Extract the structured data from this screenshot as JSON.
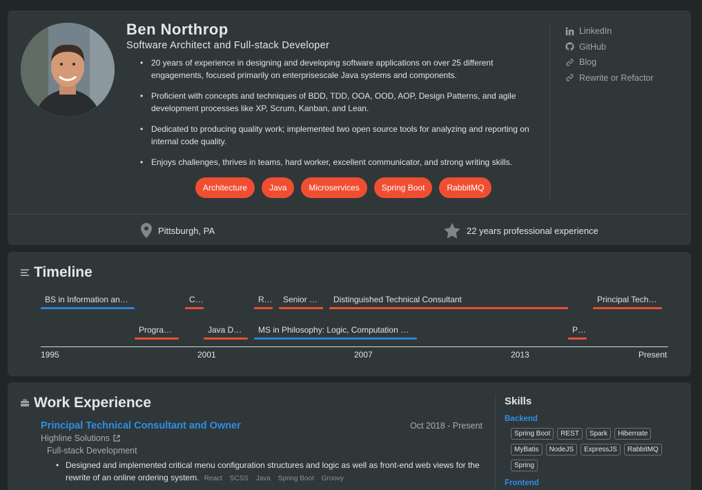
{
  "profile": {
    "name": "Ben Northrop",
    "role": "Software Architect and Full-stack Developer",
    "bullets": [
      "20 years of experience in designing and developing software applications on over 25 different engagements, focused primarily on enterprisescale Java systems and components.",
      "Proficient with concepts and techniques of BDD, TDD, OOA, OOD, AOP, Design Patterns, and agile development processes like XP, Scrum, Kanban, and Lean.",
      "Dedicated to producing quality work; implemented two open source tools for analyzing and reporting on internal code quality.",
      "Enjoys challenges, thrives in teams, hard worker, excellent communicator, and strong writing skills."
    ],
    "tags": [
      "Architecture",
      "Java",
      "Microservices",
      "Spring Boot",
      "RabbitMQ"
    ],
    "links": [
      {
        "label": "LinkedIn",
        "icon": "linkedin-icon"
      },
      {
        "label": "GitHub",
        "icon": "github-icon"
      },
      {
        "label": "Blog",
        "icon": "link-icon"
      },
      {
        "label": "Rewrite or Refactor",
        "icon": "link-icon"
      }
    ],
    "location": "Pittsburgh, PA",
    "experience": "22 years professional experience"
  },
  "timeline": {
    "title": "Timeline",
    "items": [
      {
        "label": "BS in Information and ...",
        "type": "education"
      },
      {
        "label": "Co...",
        "type": "work"
      },
      {
        "label": "Re...",
        "type": "work"
      },
      {
        "label": "Senior C...",
        "type": "work"
      },
      {
        "label": "Distinguished Technical Consultant",
        "type": "work"
      },
      {
        "label": "Principal Techni...",
        "type": "work"
      },
      {
        "label": "Program...",
        "type": "work"
      },
      {
        "label": "Java Dev...",
        "type": "work"
      },
      {
        "label": "MS in Philosophy: Logic, Computation and...",
        "type": "education"
      },
      {
        "label": "Pri...",
        "type": "work"
      }
    ],
    "ticks": [
      "1995",
      "2001",
      "2007",
      "2013",
      "Present"
    ]
  },
  "work": {
    "title": "Work Experience",
    "jobs": [
      {
        "title": "Principal Technical Consultant and Owner",
        "dates": "Oct 2018 - Present",
        "company": "Highline Solutions",
        "role": "Full-stack Development",
        "bullet": "Designed and implemented critical menu configuration structures and logic as well as front-end web views for the rewrite of an online ordering system.",
        "techs": [
          "React",
          "SCSS",
          "Java",
          "Spring Boot",
          "Groovy"
        ]
      }
    ]
  },
  "skills": {
    "title": "Skills",
    "categories": [
      {
        "name": "Backend",
        "items": [
          "Spring Boot",
          "REST",
          "Spark",
          "Hibernate",
          "MyBatis",
          "NodeJS",
          "ExpressJS",
          "RabbitMQ",
          "Spring"
        ]
      },
      {
        "name": "Frontend",
        "items": []
      }
    ]
  },
  "colors": {
    "accent": "#f04e30",
    "link": "#2f8ee6",
    "education": "#2c83d9",
    "card": "#2f3739",
    "background": "#212627"
  }
}
